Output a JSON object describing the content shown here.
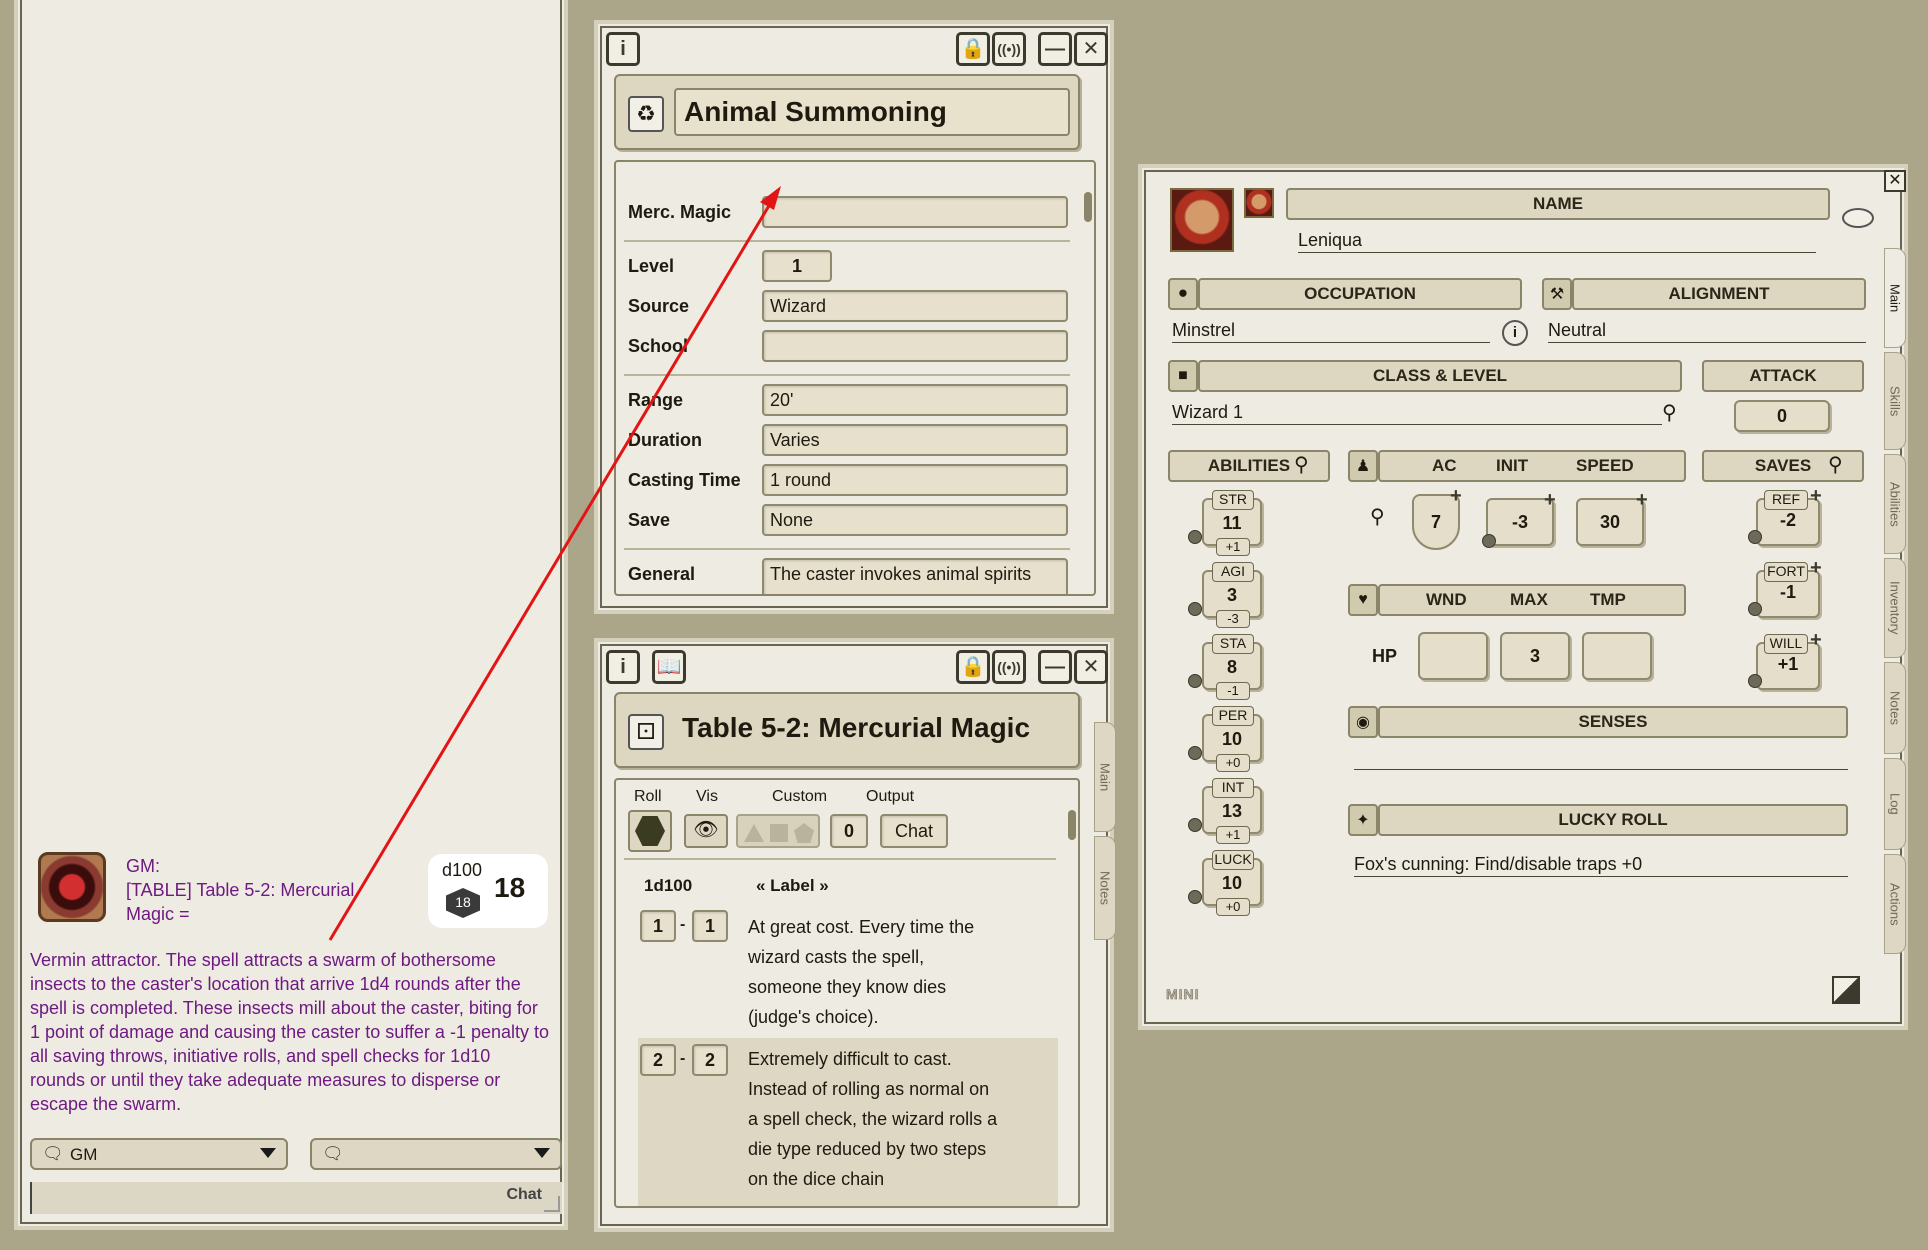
{
  "chat": {
    "sender": "GM:",
    "message": "[TABLE] Table 5-2: Mercurial Magic =",
    "die_type": "d100",
    "die_value": "18",
    "total": "18",
    "result_text": "Vermin attractor. The spell attracts a swarm of bothersome insects to the caster's location that arrive 1d4 rounds after the spell is completed. These insects mill about the caster, biting for 1 point of damage and causing the caster to suffer a -1 penalty to all saving throws, initiative rolls, and spell checks for 1d10 rounds or until they take adequate measures to disperse or escape the swarm.",
    "mode_select": "GM",
    "language_select": "",
    "send_label": "Chat"
  },
  "spell": {
    "title": "Animal Summoning",
    "fields": {
      "merc_magic_label": "Merc. Magic",
      "merc_magic_value": "",
      "level_label": "Level",
      "level_value": "1",
      "source_label": "Source",
      "source_value": "Wizard",
      "school_label": "School",
      "school_value": "",
      "range_label": "Range",
      "range_value": "20'",
      "duration_label": "Duration",
      "duration_value": "Varies",
      "casting_time_label": "Casting Time",
      "casting_time_value": "1 round",
      "save_label": "Save",
      "save_value": "None",
      "general_label": "General",
      "general_value": "The caster invokes animal spirits"
    }
  },
  "table": {
    "title": "Table 5-2: Mercurial Magic",
    "controls": {
      "roll_label": "Roll",
      "vis_label": "Vis",
      "custom_label": "Custom",
      "output_label": "Output",
      "custom_value": "0",
      "output_value": "Chat"
    },
    "dice_header": "1d100",
    "label_header": "« Label »",
    "rows": [
      {
        "from": "1",
        "to": "1",
        "text": "At great cost. Every time the wizard casts the spell, someone they know dies (judge's choice)."
      },
      {
        "from": "2",
        "to": "2",
        "text": "Extremely difficult to cast. Instead of rolling as normal on a spell check, the wizard rolls a die type reduced by two steps on the dice chain"
      }
    ],
    "side_tabs": [
      "Main",
      "Notes"
    ]
  },
  "character": {
    "name_header": "NAME",
    "name": "Leniqua",
    "occupation_header": "OCCUPATION",
    "occupation": "Minstrel",
    "alignment_header": "ALIGNMENT",
    "alignment": "Neutral",
    "class_header": "CLASS & LEVEL",
    "class_level": "Wizard 1",
    "attack_header": "ATTACK",
    "attack": "0",
    "abilities_header": "ABILITIES",
    "combat_headers": [
      "AC",
      "INIT",
      "SPEED"
    ],
    "ac": "7",
    "init": "-3",
    "speed": "30",
    "saves_header": "SAVES",
    "abilities": [
      {
        "name": "STR",
        "score": "11",
        "mod": "+1"
      },
      {
        "name": "AGI",
        "score": "3",
        "mod": "-3"
      },
      {
        "name": "STA",
        "score": "8",
        "mod": "-1"
      },
      {
        "name": "PER",
        "score": "10",
        "mod": "+0"
      },
      {
        "name": "INT",
        "score": "13",
        "mod": "+1"
      },
      {
        "name": "LUCK",
        "score": "10",
        "mod": "+0"
      }
    ],
    "saves": [
      {
        "name": "REF",
        "value": "-2"
      },
      {
        "name": "FORT",
        "value": "-1"
      },
      {
        "name": "WILL",
        "value": "+1"
      }
    ],
    "hp_headers": [
      "WND",
      "MAX",
      "TMP"
    ],
    "hp_label": "HP",
    "hp_wounds": "",
    "hp_max": "3",
    "hp_temp": "",
    "senses_header": "SENSES",
    "senses": "",
    "lucky_roll_header": "LUCKY ROLL",
    "lucky_roll": "Fox's cunning: Find/disable traps +0",
    "mini_label": "MINI",
    "side_tabs": [
      "Main",
      "Skills",
      "Abilities",
      "Inventory",
      "Notes",
      "Log",
      "Actions"
    ]
  }
}
